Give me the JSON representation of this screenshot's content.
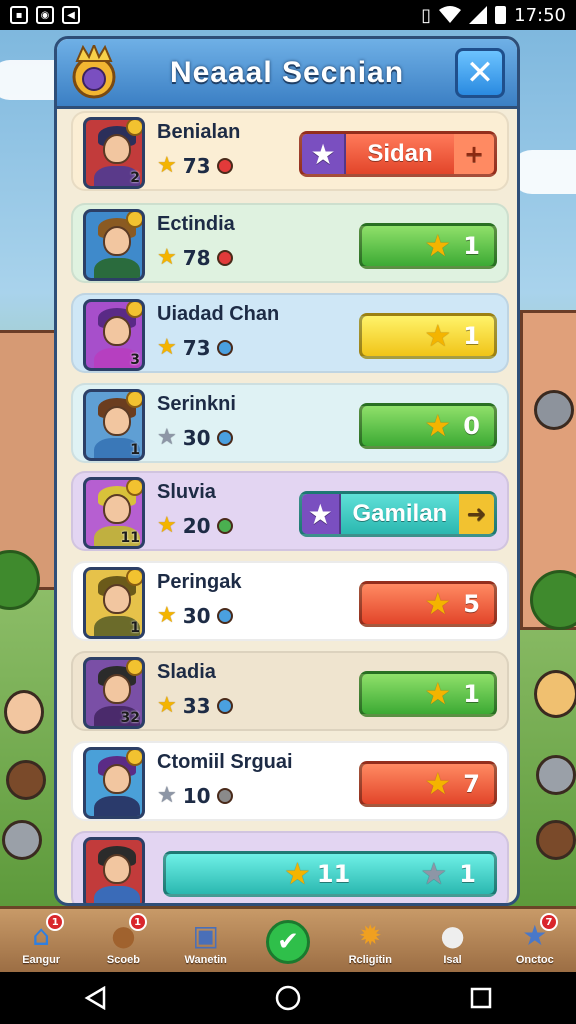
{
  "status_bar": {
    "time": "17:50"
  },
  "panel": {
    "title": "Neaaal Secnian",
    "close_label": "✕"
  },
  "players": [
    {
      "name": "Benialan",
      "stars": "73",
      "rank": "2",
      "star_type": "gold",
      "action": {
        "style": "wide",
        "label": "Sidan",
        "cap": "+"
      }
    },
    {
      "name": "Ectindia",
      "stars": "78",
      "rank": "",
      "star_type": "gold",
      "action": {
        "style": "green",
        "count": "1"
      }
    },
    {
      "name": "Uiadad Chan",
      "stars": "73",
      "rank": "3",
      "star_type": "gold",
      "action": {
        "style": "yellow",
        "count": "1"
      }
    },
    {
      "name": "Serinkni",
      "stars": "30",
      "rank": "1",
      "star_type": "grey",
      "action": {
        "style": "green",
        "count": "0"
      }
    },
    {
      "name": "Sluvia",
      "stars": "20",
      "rank": "11",
      "star_type": "gold",
      "action": {
        "style": "wide",
        "label": "Gamilan",
        "cap": "➜"
      }
    },
    {
      "name": "Peringak",
      "stars": "30",
      "rank": "1",
      "star_type": "gold",
      "action": {
        "style": "red",
        "count": "5"
      }
    },
    {
      "name": "Sladia",
      "stars": "33",
      "rank": "32",
      "star_type": "gold",
      "action": {
        "style": "green",
        "count": "1"
      }
    },
    {
      "name": "Ctomiil Srguai",
      "stars": "10",
      "rank": "",
      "star_type": "grey",
      "action": {
        "style": "red",
        "count": "7"
      }
    }
  ],
  "last_row": {
    "left_count": "11",
    "right_count": "1"
  },
  "bottom_nav": [
    {
      "label": "Eangur",
      "icon": "house-icon",
      "badge": "1"
    },
    {
      "label": "Scoeb",
      "icon": "bear-icon",
      "badge": "1"
    },
    {
      "label": "Wanetin",
      "icon": "robot-icon",
      "badge": ""
    },
    {
      "label": "",
      "icon": "check-icon",
      "badge": ""
    },
    {
      "label": "Rcligitin",
      "icon": "sun-icon",
      "badge": ""
    },
    {
      "label": "Isal",
      "icon": "cat-icon",
      "badge": ""
    },
    {
      "label": "Onctoc",
      "icon": "star-icon",
      "badge": "7"
    }
  ],
  "colors": {
    "header_blue": "#3b7fc4",
    "panel_bg": "#f4ecd8",
    "green_btn": "#3caa34",
    "red_btn": "#e2452a",
    "yellow_btn": "#f0c418",
    "teal_btn": "#2bb8b0"
  }
}
